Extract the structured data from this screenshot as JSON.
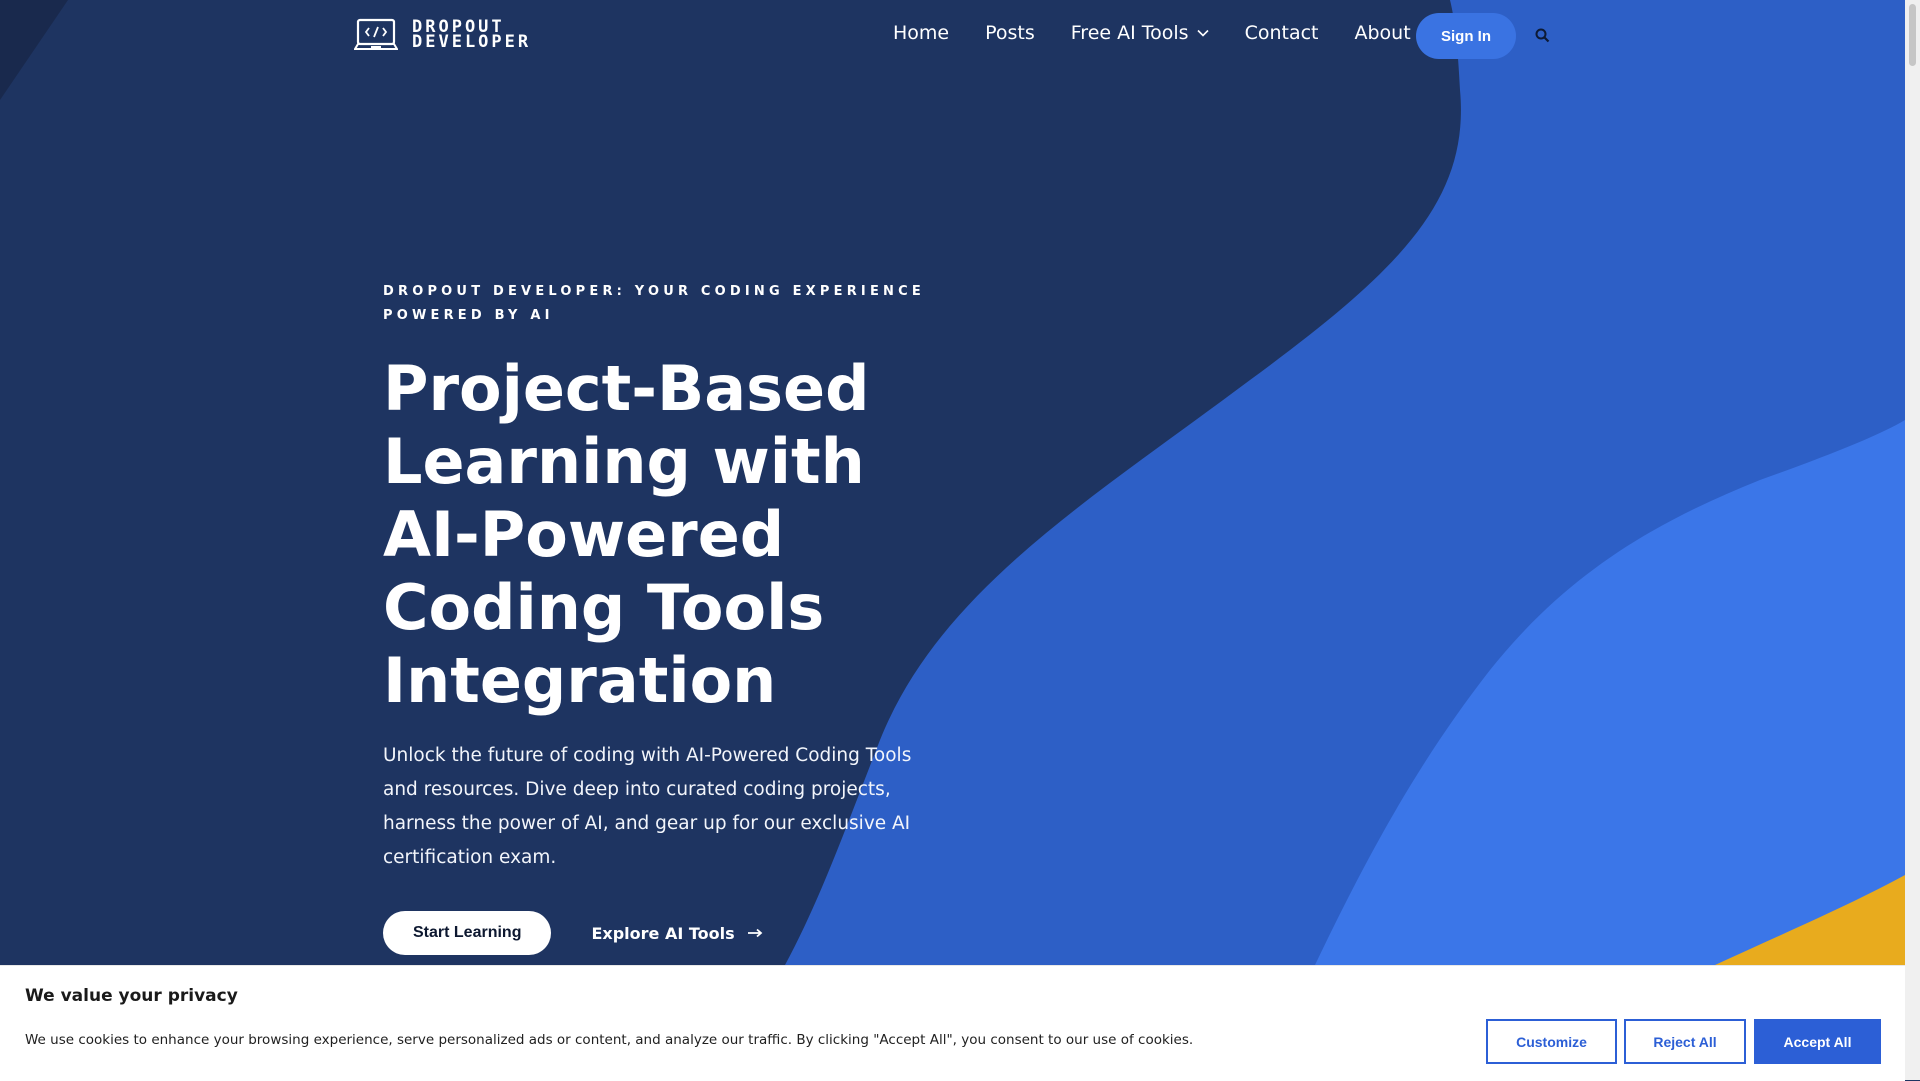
{
  "colors": {
    "background": "#1e3461",
    "accent_blue": "#3a73e2",
    "wave_dark": "#2d5fc6",
    "wave_light": "#3b76e8",
    "accent_yellow": "#e8ab1e",
    "cookie_button": "#2c5fd6"
  },
  "brand": {
    "line1": "DROPOUT",
    "line2": "DEVELOPER",
    "icon": "laptop-code-icon"
  },
  "nav": {
    "items": [
      {
        "label": "Home"
      },
      {
        "label": "Posts"
      },
      {
        "label": "Free AI Tools",
        "icon": "chevron-down-icon"
      },
      {
        "label": "Contact"
      },
      {
        "label": "About"
      }
    ],
    "signin_label": "Sign In",
    "search_icon": "search-icon"
  },
  "hero": {
    "eyebrow": "DROPOUT DEVELOPER: YOUR CODING EXPERIENCE POWERED BY AI",
    "title": "Project-Based Learning with AI-Powered Coding Tools Integration",
    "description": "Unlock the future of coding with AI-Powered Coding Tools and resources. Dive deep into curated coding projects, harness the power of AI, and gear up for our exclusive AI certification exam.",
    "primary_cta": "Start Learning",
    "secondary_cta": "Explore AI Tools",
    "secondary_icon": "arrow-right-icon"
  },
  "cookie": {
    "title": "We value your privacy",
    "text": "We use cookies to enhance your browsing experience, serve personalized ads or content, and analyze our traffic. By clicking \"Accept All\", you consent to our use of cookies.",
    "customize_label": "Customize",
    "reject_label": "Reject All",
    "accept_label": "Accept All"
  }
}
